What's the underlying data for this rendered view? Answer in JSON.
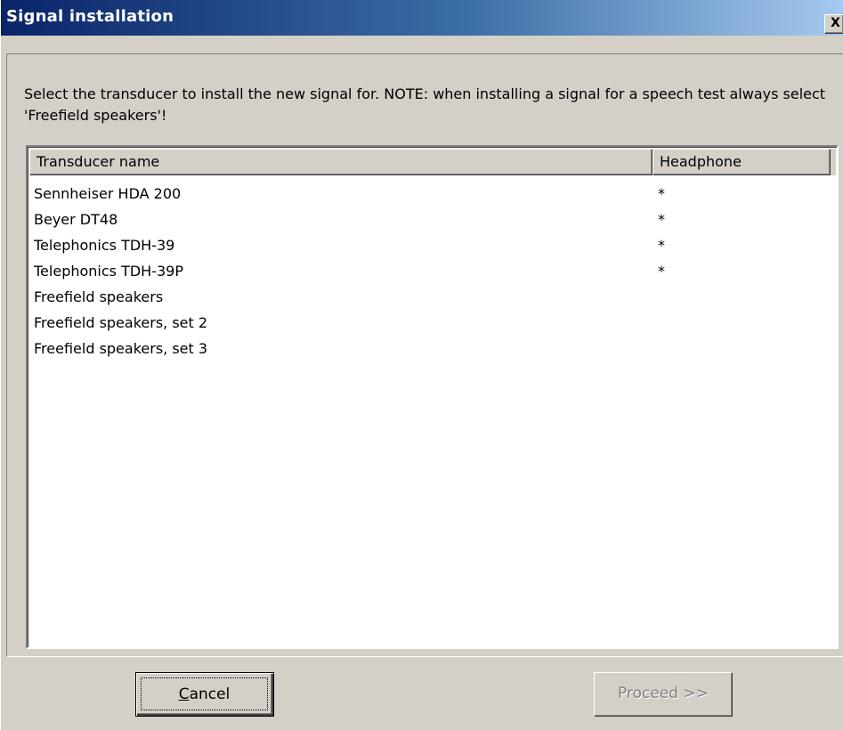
{
  "window": {
    "title": "Signal installation",
    "close_label": "X"
  },
  "instruction": "Select the transducer to install the new signal for. NOTE: when installing a signal for a speech test always select 'Freefield speakers'!",
  "list": {
    "columns": [
      "Transducer name",
      "Headphone"
    ],
    "rows": [
      {
        "name": "Sennheiser HDA 200",
        "headphone": "*"
      },
      {
        "name": "Beyer DT48",
        "headphone": "*"
      },
      {
        "name": "Telephonics TDH-39",
        "headphone": "*"
      },
      {
        "name": "Telephonics TDH-39P",
        "headphone": "*"
      },
      {
        "name": "Freefield speakers",
        "headphone": ""
      },
      {
        "name": "Freefield speakers, set 2",
        "headphone": ""
      },
      {
        "name": "Freefield speakers, set 3",
        "headphone": ""
      }
    ]
  },
  "buttons": {
    "cancel_mnemonic": "C",
    "cancel_rest": "ancel",
    "proceed_label": "Proceed >>",
    "proceed_enabled": false
  },
  "colors": {
    "titlebar_start": "#0a246a",
    "titlebar_end": "#a6caf0",
    "face": "#d4d0c8"
  }
}
